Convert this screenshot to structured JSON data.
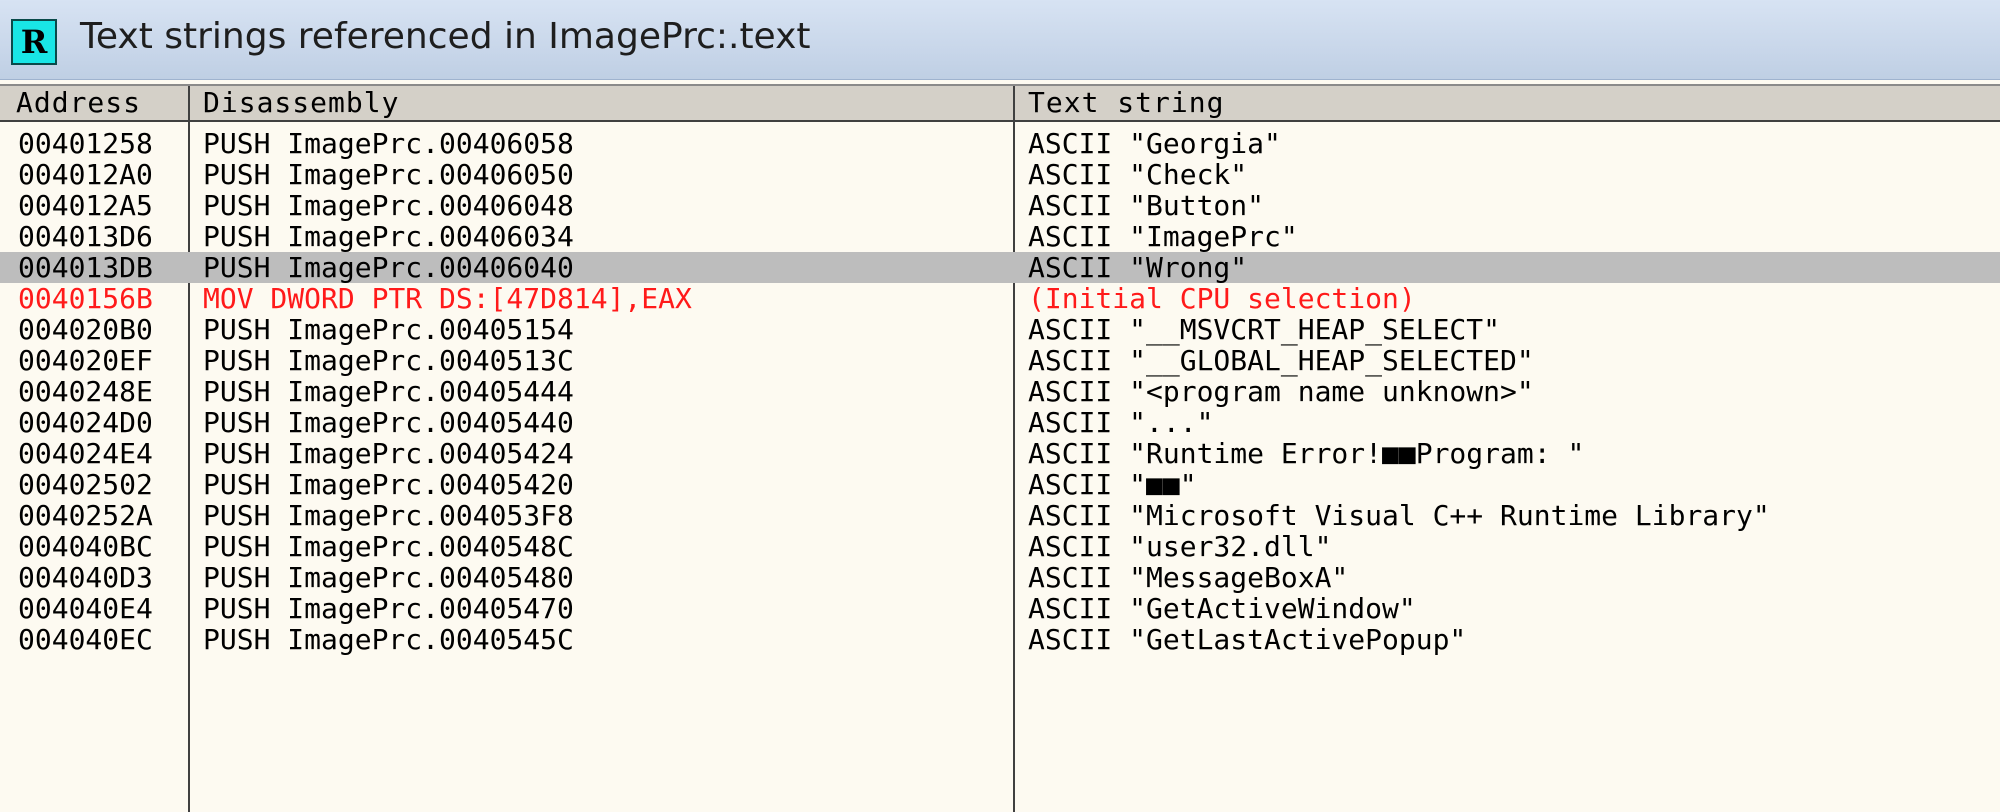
{
  "window": {
    "icon_letter": "R",
    "title": "Text strings referenced in ImagePrc:.text"
  },
  "columns": {
    "address": "Address",
    "disassembly": "Disassembly",
    "text_string": "Text string"
  },
  "rows": [
    {
      "address": "00401258",
      "disassembly": "PUSH ImagePrc.00406058",
      "text": "ASCII \"Georgia\""
    },
    {
      "address": "004012A0",
      "disassembly": "PUSH ImagePrc.00406050",
      "text": "ASCII \"Check\""
    },
    {
      "address": "004012A5",
      "disassembly": "PUSH ImagePrc.00406048",
      "text": "ASCII \"Button\""
    },
    {
      "address": "004013D6",
      "disassembly": "PUSH ImagePrc.00406034",
      "text": "ASCII \"ImagePrc\""
    },
    {
      "address": "004013DB",
      "disassembly": "PUSH ImagePrc.00406040",
      "text": "ASCII \"Wrong\""
    },
    {
      "address": "0040156B",
      "disassembly": "MOV DWORD PTR DS:[47D814],EAX",
      "text": "(Initial CPU selection)"
    },
    {
      "address": "004020B0",
      "disassembly": "PUSH ImagePrc.00405154",
      "text": "ASCII \"__MSVCRT_HEAP_SELECT\""
    },
    {
      "address": "004020EF",
      "disassembly": "PUSH ImagePrc.0040513C",
      "text": "ASCII \"__GLOBAL_HEAP_SELECTED\""
    },
    {
      "address": "0040248E",
      "disassembly": "PUSH ImagePrc.00405444",
      "text": "ASCII \"<program name unknown>\""
    },
    {
      "address": "004024D0",
      "disassembly": "PUSH ImagePrc.00405440",
      "text": "ASCII \"...\""
    },
    {
      "address": "004024E4",
      "disassembly": "PUSH ImagePrc.00405424",
      "text": "ASCII \"Runtime Error!■■Program: \""
    },
    {
      "address": "00402502",
      "disassembly": "PUSH ImagePrc.00405420",
      "text": "ASCII \"■■\""
    },
    {
      "address": "0040252A",
      "disassembly": "PUSH ImagePrc.004053F8",
      "text": "ASCII \"Microsoft Visual C++ Runtime Library\""
    },
    {
      "address": "004040BC",
      "disassembly": "PUSH ImagePrc.0040548C",
      "text": "ASCII \"user32.dll\""
    },
    {
      "address": "004040D3",
      "disassembly": "PUSH ImagePrc.00405480",
      "text": "ASCII \"MessageBoxA\""
    },
    {
      "address": "004040E4",
      "disassembly": "PUSH ImagePrc.00405470",
      "text": "ASCII \"GetActiveWindow\""
    },
    {
      "address": "004040EC",
      "disassembly": "PUSH ImagePrc.0040545C",
      "text": "ASCII \"GetLastActivePopup\""
    }
  ],
  "selected_row_index": 4,
  "initial_cpu_row_index": 5,
  "colors": {
    "selection": "#bdbdbd",
    "initial_cpu_text": "#ff1a1a",
    "background": "#fdfaf1",
    "icon_bg": "#19e6e6"
  }
}
